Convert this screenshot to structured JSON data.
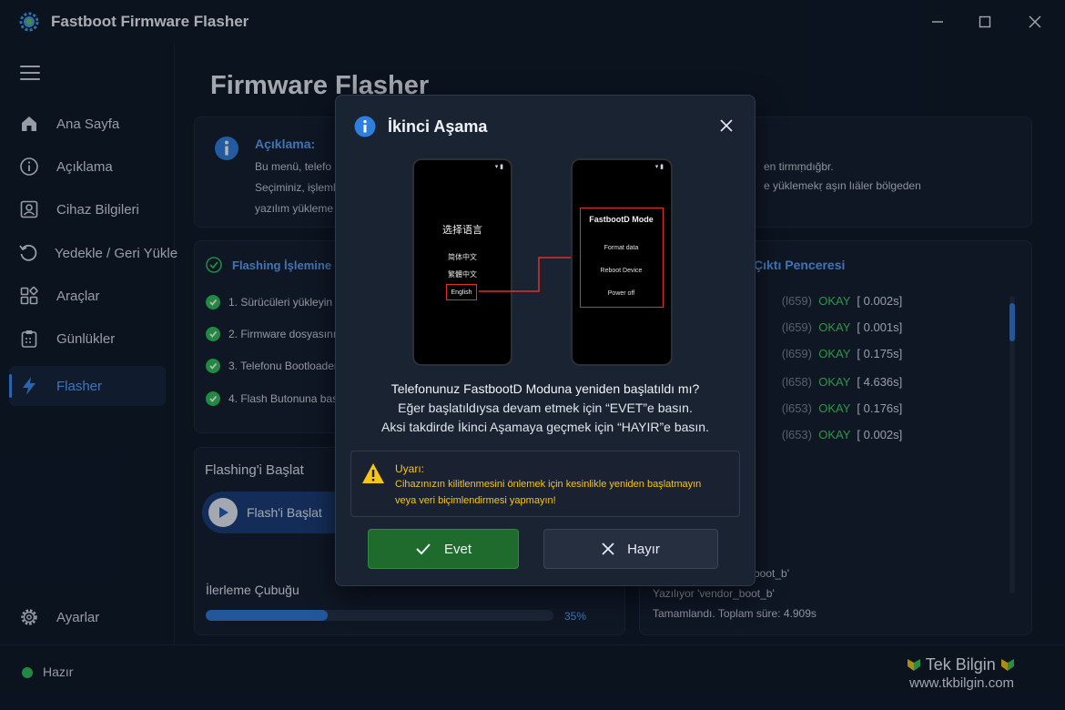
{
  "window": {
    "title": "Fastboot Firmware Flasher"
  },
  "sidebar": {
    "items": [
      {
        "label": "Ana Sayfa",
        "icon": "home-icon"
      },
      {
        "label": "Açıklama",
        "icon": "info-icon"
      },
      {
        "label": "Cihaz Bilgileri",
        "icon": "device-info-icon"
      },
      {
        "label": "Yedekle / Geri Yükle",
        "icon": "restore-icon"
      },
      {
        "label": "Araçlar",
        "icon": "tools-icon"
      },
      {
        "label": "Günlükler",
        "icon": "logs-icon"
      },
      {
        "label": "Flasher",
        "icon": "lightning-icon",
        "active": true
      }
    ],
    "settings_label": "Ayarlar"
  },
  "main": {
    "title": "Firmware Flasher",
    "description": {
      "heading": "Açıklama:",
      "line1": "Bu menü, telefo",
      "line2": "Seçiminiz, işleml",
      "line3": "yazılım yükleme",
      "right1": "en tirmṃdığbr.",
      "right2": "e yüklemekṛ aşın lıäler bölgeden"
    },
    "steps_card": {
      "heading": "Flashing İşlemine B",
      "steps": [
        "1. Sürücüleri yükleyin",
        "2. Firmware dosyasını aç",
        "3. Telefonu Bootloader mo",
        "4. Flash Butonuna basın"
      ]
    },
    "start_card": {
      "heading": "Flashing'i Başlat",
      "button_label": "Flash'i Başlat",
      "progress_label": "İlerleme Çubuğu",
      "progress_percent": "35%",
      "progress_value": 0.35
    },
    "output_card": {
      "heading": "Çıktı Penceresi",
      "lines": [
        {
          "prefix": "(l659)",
          "status": "OKAY",
          "time": "[ 0.002s]"
        },
        {
          "prefix": "(l659)",
          "status": "OKAY",
          "time": "[ 0.001s]"
        },
        {
          "prefix": "(l659)",
          "status": "OKAY",
          "time": "[ 0.175s]"
        },
        {
          "prefix": "(l658)",
          "status": "OKAY",
          "time": "[ 4.636s]"
        },
        {
          "prefix": "(l653)",
          "status": "OKAY",
          "time": "[ 0.176s]"
        },
        {
          "prefix": "(l653)",
          "status": "OKAY",
          "time": "[ 0.002s]"
        }
      ],
      "tail": [
        "boot_b'",
        "Yazılıyor 'vendor_boot_b'",
        "Tamamlandı. Toplam süre: 4.909s"
      ]
    }
  },
  "status": {
    "text": "Hazır"
  },
  "brand": {
    "name": "Tek Bilgin",
    "url": "www.tkbilgin.com"
  },
  "modal": {
    "title": "İkinci Aşama",
    "phone1": {
      "title": "选择语言",
      "options": [
        "简体中文",
        "繁體中文",
        "English"
      ],
      "highlighted": "English"
    },
    "phone2": {
      "title": "FastbootD Mode",
      "options": [
        "Format data",
        "Reboot Device",
        "Power off"
      ]
    },
    "question": "Telefonunuz FastbootD Moduna yeniden başlatıldı mı?",
    "line2": "Eğer başlatıldıysa devam etmek için “EVET”e basın.",
    "line3": "Aksi takdirde İkinci Aşamaya geçmek için “HAYIR”e basın.",
    "warning": {
      "title": "Uyarı:",
      "line1": "Cihazınızın kilitlenmesini önlemek için kesinlikle yeniden başlatmayın",
      "line2": "veya veri biçimlendirmesi yapmayın!"
    },
    "yes_label": "Evet",
    "no_label": "Hayır"
  },
  "colors": {
    "accent": "#3b8cf0",
    "ok_green": "#3ed35b",
    "warning_yellow": "#f5c518",
    "yes_button": "#1f6b2d",
    "highlight_red": "#e0302e"
  }
}
